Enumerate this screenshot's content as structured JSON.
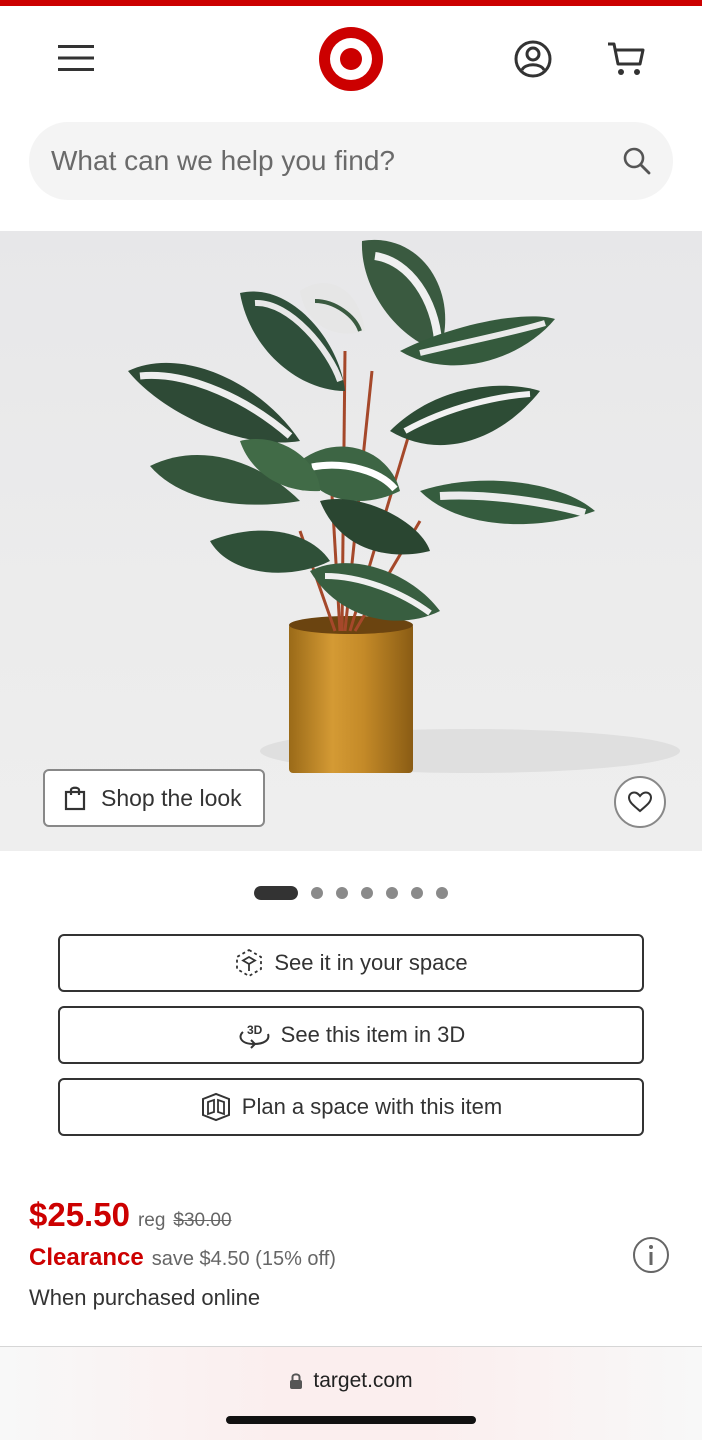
{
  "search": {
    "placeholder": "What can we help you find?"
  },
  "hero": {
    "shop_the_look_label": "Shop the look",
    "carousel_count": 7,
    "carousel_active_index": 0
  },
  "actions": {
    "see_in_space": "See it in your space",
    "see_in_3d": "See this item in 3D",
    "plan_space": "Plan a space with this item"
  },
  "pricing": {
    "price": "$25.50",
    "reg_label": "reg",
    "reg_price": "$30.00",
    "clearance_label": "Clearance",
    "save_text": "save $4.50 (15% off)",
    "purchase_note": "When purchased online"
  },
  "browser": {
    "url": "target.com"
  },
  "colors": {
    "brand": "#cc0000",
    "text": "#333333",
    "muted": "#666666"
  },
  "icons": {
    "menu": "hamburger-menu-icon",
    "logo": "target-bullseye-logo",
    "account": "account-icon",
    "cart": "cart-icon",
    "search": "search-icon",
    "bag": "shopping-bag-icon",
    "heart": "heart-icon",
    "ar": "ar-cube-icon",
    "three_d": "3d-rotate-icon",
    "plan": "room-plan-icon",
    "info": "info-icon",
    "lock": "lock-icon"
  }
}
